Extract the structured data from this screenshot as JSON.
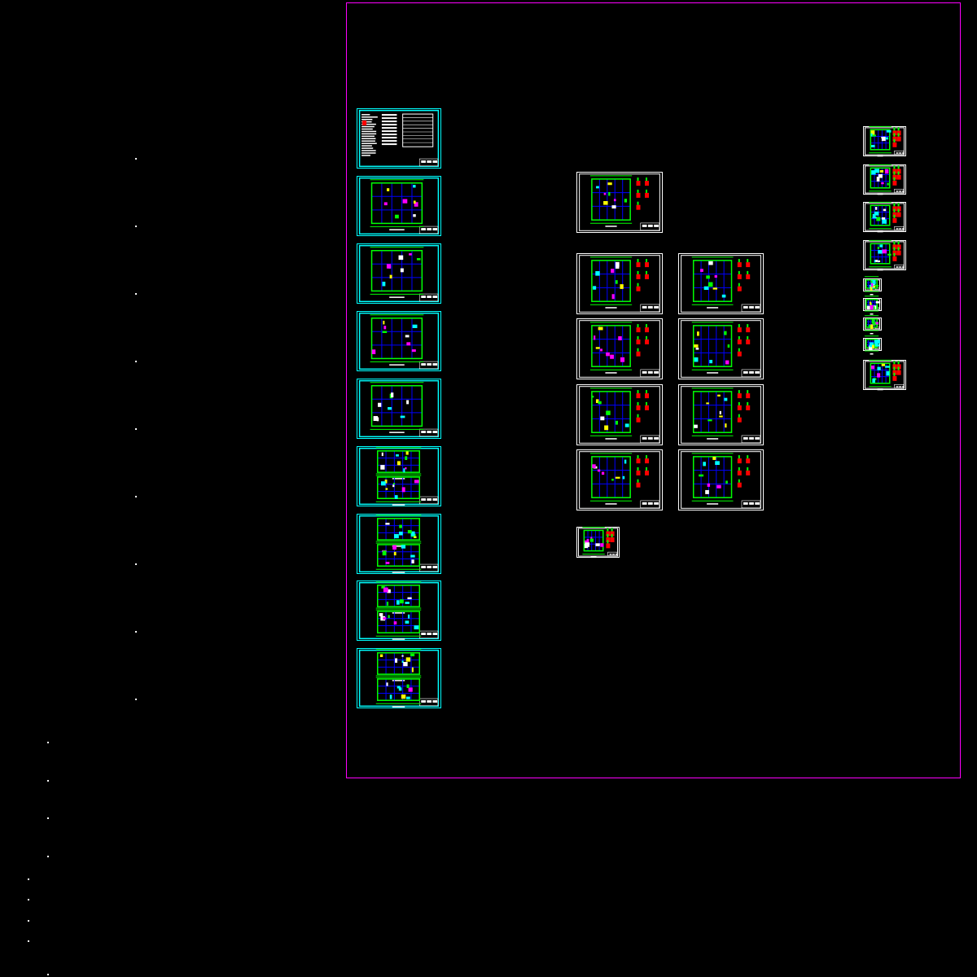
{
  "viewport": {
    "background_color": "#000000",
    "layout_border_color": "#ff00ff"
  },
  "colors": {
    "architectural_frame": "#00ffff",
    "structural_frame": "#ffffff",
    "walls": "#00ff00",
    "axis_lines": "#0000ff",
    "columns": "#ff00ff",
    "beams": "#ffff00",
    "notes": "#ffffff",
    "highlight": "#ff0000"
  },
  "sheet_groups": [
    {
      "group": "architectural",
      "frame": "cyan",
      "count": 9
    },
    {
      "group": "structural",
      "frame": "white",
      "count": 10
    },
    {
      "group": "details",
      "frame": "white",
      "count": 9
    }
  ]
}
